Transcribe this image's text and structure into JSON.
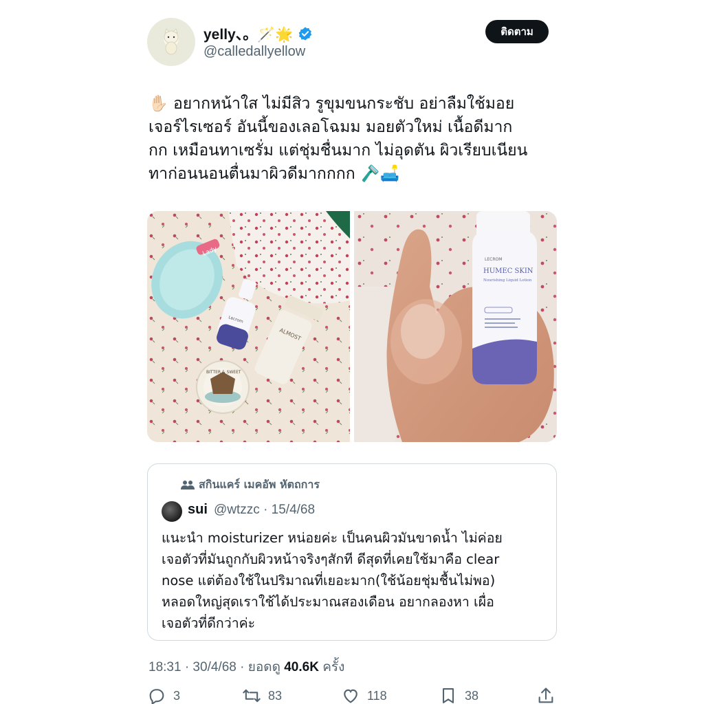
{
  "author": {
    "display_name": "yelly、。🪄🌟",
    "handle": "@calledallyellow",
    "verified": true,
    "avatar_icon": "kitty-plush-avatar"
  },
  "follow_button": {
    "label": "ติดตาม"
  },
  "tweet": {
    "lines": [
      "✋🏻 อยากหน้าใส ไม่มีสิว รูขุมขนกระชับ อย่าลืมใช้มอย",
      "เจอร์ไรเซอร์ อันนี้ของเลอโฉมม  มอยตัวใหม่ เนื้อดีมาก",
      "กก เหมือนทาเซรั่ม แต่ชุ่มชื่นมาก ไม่อุดตัน ผิวเรียบเนียน",
      "ทาก่อนนอนตื่นมาผิวดีมากกกก 🪒🛋️"
    ]
  },
  "media": {
    "left_photo": {
      "subject": "skincare products on floral pouch",
      "texts": [
        "Lady",
        "Lecrom",
        "ALMOST",
        "BITTER & SWEET"
      ]
    },
    "right_photo": {
      "subject": "hand holding lotion bottle",
      "texts": [
        "LECROM",
        "HUMEC SKIN",
        "Nourishing Liquid Lotion"
      ]
    }
  },
  "quote": {
    "community": "สกินแคร์ เมคอัพ หัตถการ",
    "name": "sui",
    "meta": "@wtzzc · 15/4/68",
    "lines": [
      "แนะนำ moisturizer หน่อยค่ะ เป็นคนผิวมันขาดน้ำ ไม่ค่อย",
      "เจอตัวที่มันถูกกับผิวหน้าจริงๆสักที ดีสุดที่เคยใช้มาคือ clear",
      "nose แต่ต้องใช้ในปริมาณที่เยอะมาก(ใช้น้อยชุ่มชื้นไม่พอ)",
      "หลอดใหญ่สุดเราใช้ได้ประมาณสองเดือน อยากลองหา เผื่อ",
      "เจอตัวที่ดีกว่าค่ะ"
    ]
  },
  "meta": {
    "time_date": "18:31 · 30/4/68 · ยอดดู ",
    "views": "40.6K",
    "views_suffix": " ครั้ง"
  },
  "actions": {
    "replies": "3",
    "retweets": "83",
    "likes": "118",
    "bookmarks": "38"
  },
  "colors": {
    "text": "#0f1419",
    "secondary": "#536471",
    "verified": "#1d9bf0",
    "border": "#cfd9de"
  }
}
